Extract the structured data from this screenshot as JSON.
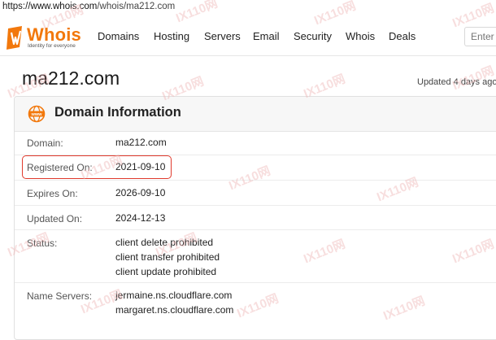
{
  "browser": {
    "url_prefix": "https://",
    "url_domain": "www.whois.com",
    "url_path": "/whois/ma212.com"
  },
  "header": {
    "logo_text": "Whois",
    "logo_tagline": "Identity for everyone",
    "nav": [
      "Domains",
      "Hosting",
      "Servers",
      "Email",
      "Security",
      "Whois",
      "Deals"
    ],
    "search_placeholder": "Enter"
  },
  "page": {
    "domain_title": "ma212.com",
    "updated": "Updated 4 days ago"
  },
  "card": {
    "title": "Domain Information",
    "rows": [
      {
        "label": "Domain:",
        "values": [
          "ma212.com"
        ]
      },
      {
        "label": "Registered On:",
        "values": [
          "2021-09-10"
        ]
      },
      {
        "label": "Expires On:",
        "values": [
          "2026-09-10"
        ]
      },
      {
        "label": "Updated On:",
        "values": [
          "2024-12-13"
        ]
      },
      {
        "label": "Status:",
        "values": [
          "client delete prohibited",
          "client transfer prohibited",
          "client update prohibited"
        ]
      },
      {
        "label": "Name Servers:",
        "values": [
          "jermaine.ns.cloudflare.com",
          "margaret.ns.cloudflare.com"
        ]
      }
    ]
  },
  "watermark_text": "IX110网",
  "colors": {
    "brand": "#f2780c",
    "highlight": "#e03b2d"
  },
  "icons": {
    "logo": "whois-shield-logo-icon",
    "card": "www-globe-icon"
  }
}
